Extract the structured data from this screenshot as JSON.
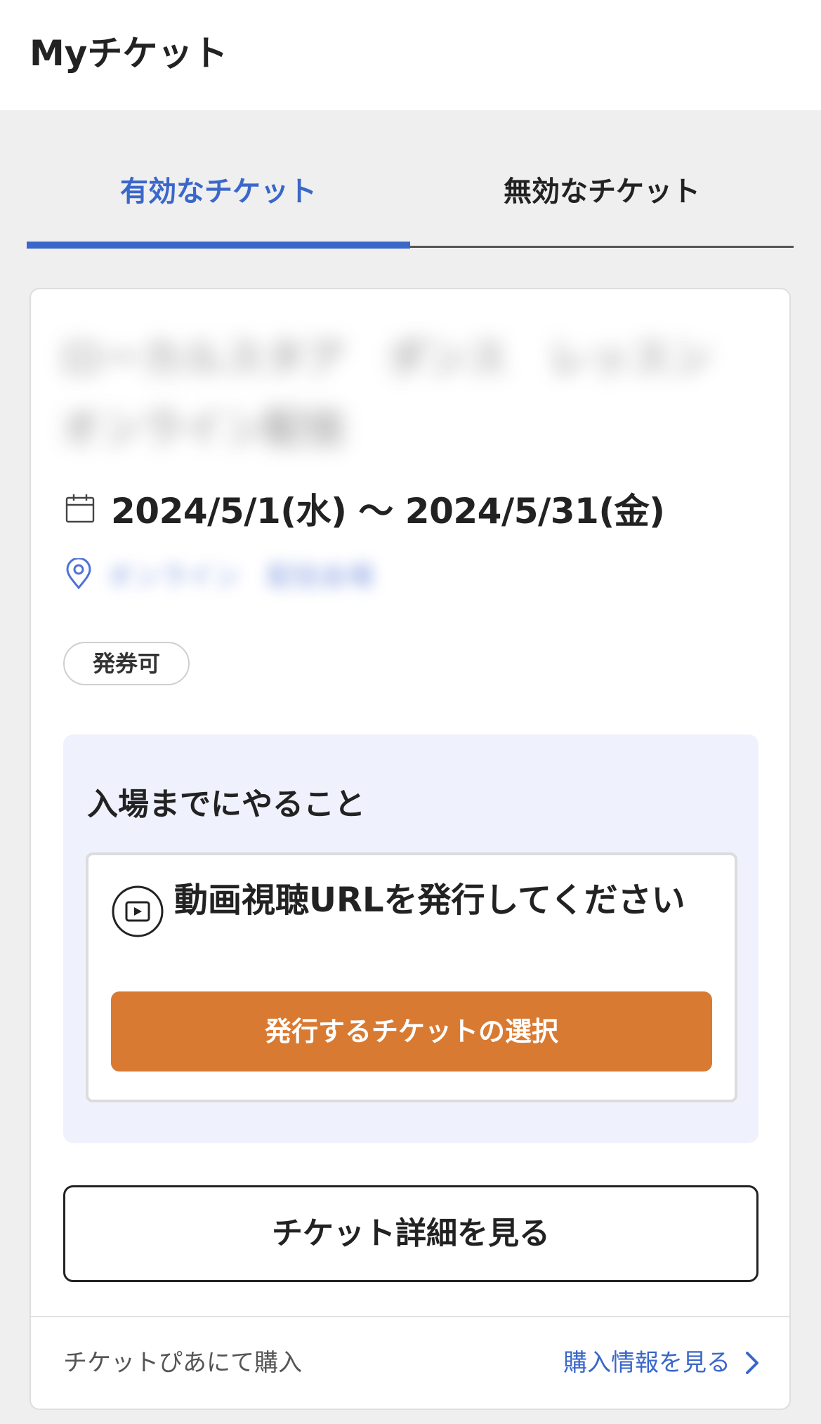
{
  "header": {
    "title": "Myチケット"
  },
  "tabs": [
    {
      "label": "有効なチケット",
      "active": true
    },
    {
      "label": "無効なチケット",
      "active": false
    }
  ],
  "ticket": {
    "event_title": "ローカルスタア　ダンス　レッスン　オンライン配信",
    "date_range": "2024/5/1(水) ～ 2024/5/31(金)",
    "venue": "オンライン　配信会場",
    "badge": "発券可",
    "todo": {
      "heading": "入場までにやること",
      "task_text": "動画視聴URLを発行してください",
      "button_label": "発行するチケットの選択"
    },
    "detail_button_label": "チケット詳細を見る",
    "footer": {
      "source_text": "チケットぴあにて購入",
      "link_text": "購入情報を見る"
    }
  },
  "colors": {
    "accent_blue": "#3a67c9",
    "orange_button": "#d97a32",
    "todo_panel_bg": "#eff2fd",
    "page_bg": "#efefef"
  },
  "icons": {
    "date": "calendar-icon",
    "venue": "map-pin-icon",
    "task": "video-play-icon",
    "link": "chevron-right-icon"
  }
}
